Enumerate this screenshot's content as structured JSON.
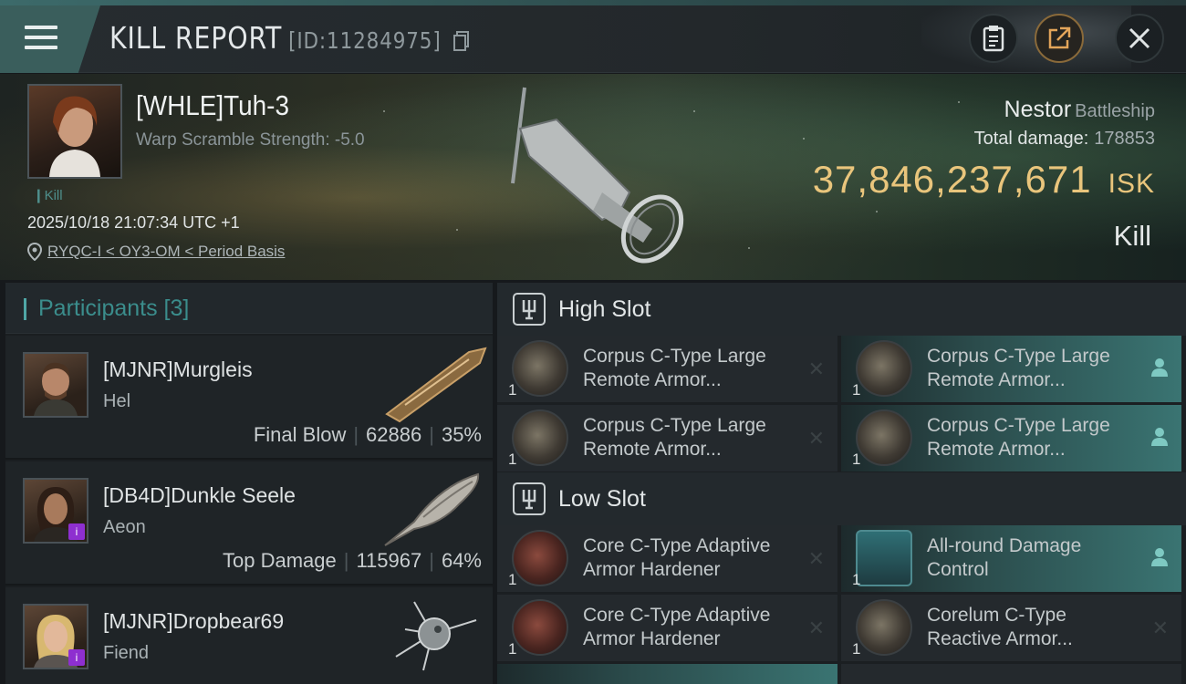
{
  "header": {
    "title": "KILL REPORT",
    "id_label": "[ID:11284975]"
  },
  "victim": {
    "name": "[WHLE]Tuh-3",
    "warp_scramble": "Warp Scramble Strength: -5.0",
    "tag": "Kill",
    "datetime": "2025/10/18 21:07:34 UTC +1",
    "location": "RYQC-I < OY3-OM < Period Basis",
    "ship_name": "Nestor",
    "ship_class": "Battleship",
    "total_damage_label": "Total damage:",
    "total_damage": "178853",
    "isk_value": "37,846,237,671",
    "isk_unit": "ISK",
    "result": "Kill"
  },
  "participants": {
    "title": "Participants [3]",
    "rows": [
      {
        "name": "[MJNR]Murgleis",
        "ship": "Hel",
        "role": "Final Blow",
        "damage": "62886",
        "pct": "35%",
        "badge": false
      },
      {
        "name": "[DB4D]Dunkle Seele",
        "ship": "Aeon",
        "role": "Top Damage",
        "damage": "115967",
        "pct": "64%",
        "badge": true
      },
      {
        "name": "[MJNR]Dropbear69",
        "ship": "Fiend",
        "role": "",
        "damage": "",
        "pct": "",
        "badge": true
      }
    ]
  },
  "slots": {
    "high": {
      "title": "High Slot",
      "modules": [
        {
          "line1": "Corpus C-Type Large",
          "line2": "Remote Armor...",
          "qty": "1"
        },
        {
          "line1": "Corpus C-Type Large",
          "line2": "Remote Armor...",
          "qty": "1"
        },
        {
          "line1": "Corpus C-Type Large",
          "line2": "Remote Armor...",
          "qty": "1"
        },
        {
          "line1": "Corpus C-Type Large",
          "line2": "Remote Armor...",
          "qty": "1"
        }
      ]
    },
    "low": {
      "title": "Low Slot",
      "modules": [
        {
          "line1": "Core C-Type Adaptive",
          "line2": "Armor Hardener",
          "qty": "1"
        },
        {
          "line1": "All-round Damage",
          "line2": "Control",
          "qty": "1"
        },
        {
          "line1": "Core C-Type Adaptive",
          "line2": "Armor Hardener",
          "qty": "1"
        },
        {
          "line1": "Corelum C-Type",
          "line2": "Reactive Armor...",
          "qty": "1"
        }
      ]
    }
  },
  "colors": {
    "accent": "#4fa7a6",
    "isk": "#e9c57c",
    "highlight": "#3a7472"
  },
  "icons": [
    "menu-icon",
    "copy-icon",
    "clipboard-icon",
    "share-icon",
    "close-icon",
    "location-pin-icon",
    "slot-icon",
    "remove-icon",
    "person-icon"
  ]
}
